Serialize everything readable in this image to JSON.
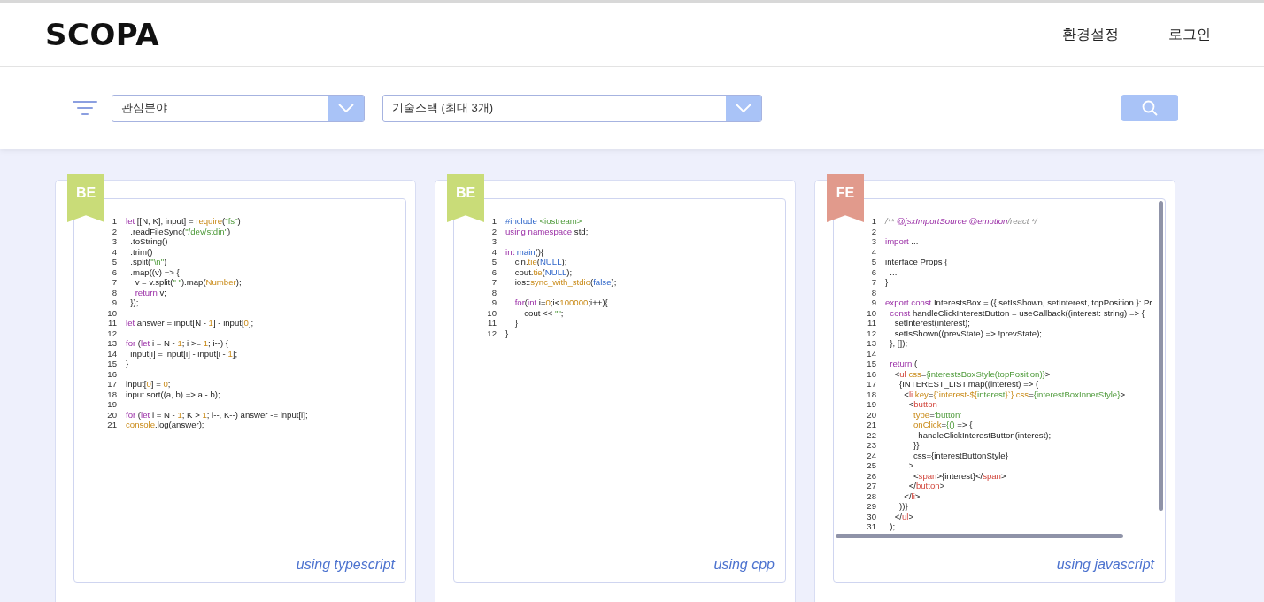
{
  "header": {
    "logo": "SCOPA",
    "nav": [
      "환경설정",
      "로그인"
    ]
  },
  "filters": {
    "selects": [
      {
        "value": "관심분야"
      },
      {
        "value": "기술스택 (최대 3개)"
      }
    ]
  },
  "cards": [
    {
      "badge": "BE",
      "color": "#c9dc78",
      "language": "using typescript",
      "scrollable": false,
      "lines": [
        {
          "n": "1",
          "code": [
            {
              "kind": "kw",
              "text": "let"
            },
            {
              "kind": "plain",
              "text": " [[N, K], input] = "
            },
            {
              "kind": "fn",
              "text": "require"
            },
            {
              "kind": "plain",
              "text": "("
            },
            {
              "kind": "str",
              "text": "\"fs\""
            },
            {
              "kind": "plain",
              "text": ")"
            }
          ]
        },
        {
          "n": "2",
          "code": [
            {
              "kind": "plain",
              "text": "  .readFileSync("
            },
            {
              "kind": "str",
              "text": "\"/dev/stdin\""
            },
            {
              "kind": "plain",
              "text": ")"
            }
          ]
        },
        {
          "n": "3",
          "code": [
            {
              "kind": "plain",
              "text": "  .toString()"
            }
          ]
        },
        {
          "n": "4",
          "code": [
            {
              "kind": "plain",
              "text": "  .trim()"
            }
          ]
        },
        {
          "n": "5",
          "code": [
            {
              "kind": "plain",
              "text": "  .split("
            },
            {
              "kind": "str",
              "text": "\"\\n\""
            },
            {
              "kind": "plain",
              "text": ")"
            }
          ]
        },
        {
          "n": "6",
          "code": [
            {
              "kind": "plain",
              "text": "  .map((v) => {"
            }
          ]
        },
        {
          "n": "7",
          "code": [
            {
              "kind": "plain",
              "text": "    v = v.split("
            },
            {
              "kind": "str",
              "text": "\" \""
            },
            {
              "kind": "plain",
              "text": ").map("
            },
            {
              "kind": "fn",
              "text": "Number"
            },
            {
              "kind": "plain",
              "text": ");"
            }
          ]
        },
        {
          "n": "8",
          "code": [
            {
              "kind": "kw",
              "text": "    return"
            },
            {
              "kind": "plain",
              "text": " v;"
            }
          ]
        },
        {
          "n": "9",
          "code": [
            {
              "kind": "plain",
              "text": "  });"
            }
          ]
        },
        {
          "n": "10"
        },
        {
          "n": "11",
          "code": [
            {
              "kind": "kw",
              "text": "let"
            },
            {
              "kind": "plain",
              "text": " answer = input[N - "
            },
            {
              "kind": "num",
              "text": "1"
            },
            {
              "kind": "plain",
              "text": "] - input["
            },
            {
              "kind": "num",
              "text": "0"
            },
            {
              "kind": "plain",
              "text": "];"
            }
          ]
        },
        {
          "n": "12"
        },
        {
          "n": "13",
          "code": [
            {
              "kind": "kw",
              "text": "for"
            },
            {
              "kind": "plain",
              "text": " ("
            },
            {
              "kind": "kw",
              "text": "let"
            },
            {
              "kind": "plain",
              "text": " i = N - "
            },
            {
              "kind": "num",
              "text": "1"
            },
            {
              "kind": "plain",
              "text": "; i >= "
            },
            {
              "kind": "num",
              "text": "1"
            },
            {
              "kind": "plain",
              "text": "; i--) {"
            }
          ]
        },
        {
          "n": "14",
          "code": [
            {
              "kind": "plain",
              "text": "  input[i] = input[i] - input[i - "
            },
            {
              "kind": "num",
              "text": "1"
            },
            {
              "kind": "plain",
              "text": "];"
            }
          ]
        },
        {
          "n": "15",
          "code": [
            {
              "kind": "plain",
              "text": "}"
            }
          ]
        },
        {
          "n": "16"
        },
        {
          "n": "17",
          "code": [
            {
              "kind": "plain",
              "text": "input["
            },
            {
              "kind": "num",
              "text": "0"
            },
            {
              "kind": "plain",
              "text": "] = "
            },
            {
              "kind": "num",
              "text": "0"
            },
            {
              "kind": "plain",
              "text": ";"
            }
          ]
        },
        {
          "n": "18",
          "code": [
            {
              "kind": "plain",
              "text": "input.sort((a, b) => a - b);"
            }
          ]
        },
        {
          "n": "19"
        },
        {
          "n": "20",
          "code": [
            {
              "kind": "kw",
              "text": "for"
            },
            {
              "kind": "plain",
              "text": " ("
            },
            {
              "kind": "kw",
              "text": "let"
            },
            {
              "kind": "plain",
              "text": " i = N - "
            },
            {
              "kind": "num",
              "text": "1"
            },
            {
              "kind": "plain",
              "text": "; K > "
            },
            {
              "kind": "num",
              "text": "1"
            },
            {
              "kind": "plain",
              "text": "; i--, K--) answer -= input[i];"
            }
          ]
        },
        {
          "n": "21",
          "code": [
            {
              "kind": "fn",
              "text": "console"
            },
            {
              "kind": "plain",
              "text": ".log(answer);"
            }
          ]
        }
      ]
    },
    {
      "badge": "BE",
      "color": "#c9dc78",
      "language": "using cpp",
      "scrollable": false,
      "lines": [
        {
          "n": "1",
          "code": [
            {
              "kind": "const",
              "text": "#include"
            },
            {
              "kind": "str",
              "text": " <iostream>"
            }
          ]
        },
        {
          "n": "2",
          "code": [
            {
              "kind": "kw",
              "text": "using namespace"
            },
            {
              "kind": "plain",
              "text": " std;"
            }
          ]
        },
        {
          "n": "3"
        },
        {
          "n": "4",
          "code": [
            {
              "kind": "kw",
              "text": "int "
            },
            {
              "kind": "const",
              "text": "main"
            },
            {
              "kind": "plain",
              "text": "(){"
            }
          ]
        },
        {
          "n": "5",
          "code": [
            {
              "kind": "plain",
              "text": "    cin."
            },
            {
              "kind": "fn",
              "text": "tie"
            },
            {
              "kind": "plain",
              "text": "("
            },
            {
              "kind": "const",
              "text": "NULL"
            },
            {
              "kind": "plain",
              "text": ");"
            }
          ]
        },
        {
          "n": "6",
          "code": [
            {
              "kind": "plain",
              "text": "    cout."
            },
            {
              "kind": "fn",
              "text": "tie"
            },
            {
              "kind": "plain",
              "text": "("
            },
            {
              "kind": "const",
              "text": "NULL"
            },
            {
              "kind": "plain",
              "text": ");"
            }
          ]
        },
        {
          "n": "7",
          "code": [
            {
              "kind": "plain",
              "text": "    ios::"
            },
            {
              "kind": "fn",
              "text": "sync_with_stdio"
            },
            {
              "kind": "plain",
              "text": "("
            },
            {
              "kind": "const",
              "text": "false"
            },
            {
              "kind": "plain",
              "text": ");"
            }
          ]
        },
        {
          "n": "8"
        },
        {
          "n": "9",
          "code": [
            {
              "kind": "kw",
              "text": "    for"
            },
            {
              "kind": "plain",
              "text": "("
            },
            {
              "kind": "kw",
              "text": "int"
            },
            {
              "kind": "plain",
              "text": " i="
            },
            {
              "kind": "num",
              "text": "0"
            },
            {
              "kind": "plain",
              "text": ";i<"
            },
            {
              "kind": "num",
              "text": "100000"
            },
            {
              "kind": "plain",
              "text": ";i++){"
            }
          ]
        },
        {
          "n": "10",
          "code": [
            {
              "kind": "plain",
              "text": "        cout << "
            },
            {
              "kind": "str",
              "text": "\"\""
            },
            {
              "kind": "plain",
              "text": ";"
            }
          ]
        },
        {
          "n": "11",
          "code": [
            {
              "kind": "plain",
              "text": "    }"
            }
          ]
        },
        {
          "n": "12",
          "code": [
            {
              "kind": "plain",
              "text": "}"
            }
          ]
        }
      ]
    },
    {
      "badge": "FE",
      "color": "#e19a8c",
      "language": "using javascript",
      "scrollable": true,
      "lines": [
        {
          "n": "1",
          "code": [
            {
              "kind": "comment",
              "text": "/** "
            },
            {
              "kind": "doc",
              "text": "@jsxImportSource "
            },
            {
              "kind": "doc",
              "text": "@emotion"
            },
            {
              "kind": "comment",
              "text": "/react */"
            }
          ]
        },
        {
          "n": "2"
        },
        {
          "n": "3",
          "code": [
            {
              "kind": "kw",
              "text": "import"
            },
            {
              "kind": "plain",
              "text": " ..."
            }
          ]
        },
        {
          "n": "4"
        },
        {
          "n": "5",
          "code": [
            {
              "kind": "plain",
              "text": "interface Props {"
            }
          ]
        },
        {
          "n": "6",
          "code": [
            {
              "kind": "plain",
              "text": "  ..."
            }
          ]
        },
        {
          "n": "7",
          "code": [
            {
              "kind": "plain",
              "text": "}"
            }
          ]
        },
        {
          "n": "8"
        },
        {
          "n": "9",
          "code": [
            {
              "kind": "kw",
              "text": "export const"
            },
            {
              "kind": "plain",
              "text": " InterestsBox = ({ setIsShown, setInterest, topPosition }: Pr"
            }
          ]
        },
        {
          "n": "10",
          "code": [
            {
              "kind": "kw",
              "text": "  const"
            },
            {
              "kind": "plain",
              "text": " handleClickInterestButton = useCallback((interest: string) => {"
            }
          ]
        },
        {
          "n": "11",
          "code": [
            {
              "kind": "plain",
              "text": "    setInterest(interest);"
            }
          ]
        },
        {
          "n": "12",
          "code": [
            {
              "kind": "plain",
              "text": "    setIsShown((prevState) => !prevState);"
            }
          ]
        },
        {
          "n": "13",
          "code": [
            {
              "kind": "plain",
              "text": "  }, []);"
            }
          ]
        },
        {
          "n": "14"
        },
        {
          "n": "15",
          "code": [
            {
              "kind": "kw",
              "text": "  return"
            },
            {
              "kind": "plain",
              "text": " ("
            }
          ]
        },
        {
          "n": "16",
          "code": [
            {
              "kind": "plain",
              "text": "    <"
            },
            {
              "kind": "tag",
              "text": "ul"
            },
            {
              "kind": "fn",
              "text": " css"
            },
            {
              "kind": "plain",
              "text": "="
            },
            {
              "kind": "str",
              "text": "{interestsBoxStyle(topPosition)}"
            },
            {
              "kind": "plain",
              "text": ">"
            }
          ]
        },
        {
          "n": "17",
          "code": [
            {
              "kind": "plain",
              "text": "      {INTEREST_LIST.map((interest) => ("
            }
          ]
        },
        {
          "n": "18",
          "code": [
            {
              "kind": "plain",
              "text": "        <"
            },
            {
              "kind": "tag",
              "text": "li"
            },
            {
              "kind": "fn",
              "text": " key"
            },
            {
              "kind": "plain",
              "text": "="
            },
            {
              "kind": "fn",
              "text": "{`interest-${"
            },
            {
              "kind": "str",
              "text": "interest"
            },
            {
              "kind": "fn",
              "text": "}`}"
            },
            {
              "kind": "fn",
              "text": " css"
            },
            {
              "kind": "plain",
              "text": "="
            },
            {
              "kind": "str",
              "text": "{interestBoxInnerStyle}"
            },
            {
              "kind": "plain",
              "text": ">"
            }
          ]
        },
        {
          "n": "19",
          "code": [
            {
              "kind": "plain",
              "text": "          <"
            },
            {
              "kind": "tag",
              "text": "button"
            }
          ]
        },
        {
          "n": "20",
          "code": [
            {
              "kind": "fn",
              "text": "            type"
            },
            {
              "kind": "plain",
              "text": "="
            },
            {
              "kind": "str",
              "text": "'button'"
            }
          ]
        },
        {
          "n": "21",
          "code": [
            {
              "kind": "fn",
              "text": "            onClick"
            },
            {
              "kind": "plain",
              "text": "="
            },
            {
              "kind": "str",
              "text": "{()"
            },
            {
              "kind": "plain",
              "text": " => {"
            }
          ]
        },
        {
          "n": "22",
          "code": [
            {
              "kind": "plain",
              "text": "              handleClickInterestButton(interest);"
            }
          ]
        },
        {
          "n": "23",
          "code": [
            {
              "kind": "plain",
              "text": "            }}"
            }
          ]
        },
        {
          "n": "24",
          "code": [
            {
              "kind": "plain",
              "text": "            css={interestButtonStyle}"
            }
          ]
        },
        {
          "n": "25",
          "code": [
            {
              "kind": "plain",
              "text": "          >"
            }
          ]
        },
        {
          "n": "26",
          "code": [
            {
              "kind": "plain",
              "text": "            <"
            },
            {
              "kind": "tag",
              "text": "span"
            },
            {
              "kind": "plain",
              "text": ">{interest}</"
            },
            {
              "kind": "tag",
              "text": "span"
            },
            {
              "kind": "plain",
              "text": ">"
            }
          ]
        },
        {
          "n": "27",
          "code": [
            {
              "kind": "plain",
              "text": "          </"
            },
            {
              "kind": "tag",
              "text": "button"
            },
            {
              "kind": "plain",
              "text": ">"
            }
          ]
        },
        {
          "n": "28",
          "code": [
            {
              "kind": "plain",
              "text": "        </"
            },
            {
              "kind": "tag",
              "text": "li"
            },
            {
              "kind": "plain",
              "text": ">"
            }
          ]
        },
        {
          "n": "29",
          "code": [
            {
              "kind": "plain",
              "text": "      ))}"
            }
          ]
        },
        {
          "n": "30",
          "code": [
            {
              "kind": "plain",
              "text": "    </"
            },
            {
              "kind": "tag",
              "text": "ul"
            },
            {
              "kind": "plain",
              "text": ">"
            }
          ]
        },
        {
          "n": "31",
          "code": [
            {
              "kind": "plain",
              "text": "  );"
            }
          ]
        }
      ]
    }
  ]
}
